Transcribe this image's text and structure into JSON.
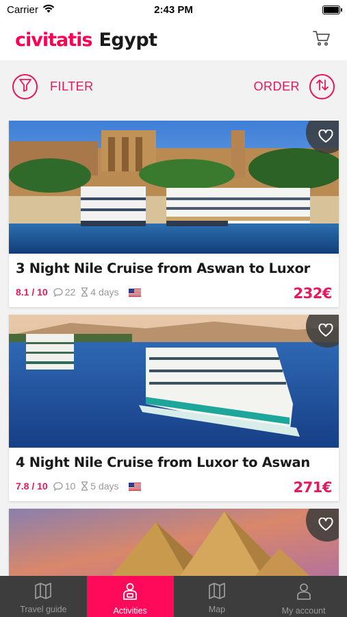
{
  "status_bar": {
    "carrier": "Carrier",
    "time": "2:43 PM"
  },
  "header": {
    "brand": "civitatis",
    "title": "Egypt",
    "cart_icon": "cart-icon"
  },
  "toolbar": {
    "filter_label": "FILTER",
    "order_label": "ORDER",
    "filter_icon": "filter-icon",
    "order_icon": "sort-icon"
  },
  "colors": {
    "brand": "#ff0055",
    "accent": "#e8175d",
    "tabbar_bg": "#3d3d3d",
    "tab_active_bg": "#ff0a5a"
  },
  "activities": [
    {
      "title": "3 Night Nile Cruise from Aswan to Luxor",
      "rating": "8.1 / 10",
      "reviews": "22",
      "duration": "4 days",
      "language_flag": "us-flag-icon",
      "price": "232€"
    },
    {
      "title": "4 Night Nile Cruise from Luxor to Aswan",
      "rating": "7.8 / 10",
      "reviews": "10",
      "duration": "5 days",
      "language_flag": "us-flag-icon",
      "price": "271€"
    },
    {
      "title": "",
      "image": "pyramids"
    }
  ],
  "tabs": [
    {
      "label": "Travel guide",
      "icon": "book-map-icon",
      "active": false
    },
    {
      "label": "Activities",
      "icon": "person-ticket-icon",
      "active": true
    },
    {
      "label": "Map",
      "icon": "map-icon",
      "active": false
    },
    {
      "label": "My account",
      "icon": "person-icon",
      "active": false
    }
  ]
}
